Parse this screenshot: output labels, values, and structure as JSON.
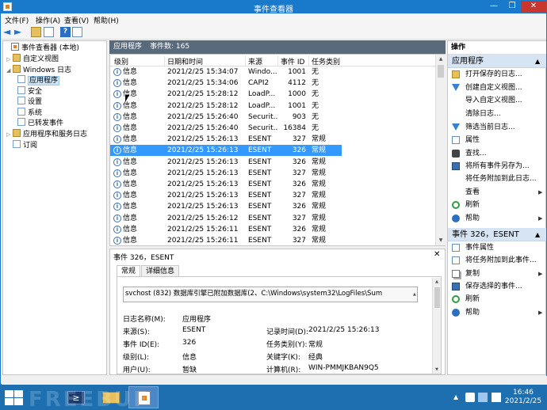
{
  "window": {
    "title": "事件查看器",
    "min": "—",
    "max": "❐",
    "close": "✕"
  },
  "menu": [
    "文件(F)",
    "操作(A)",
    "查看(V)",
    "帮助(H)"
  ],
  "toolbar": {
    "back": "◄",
    "forward": "►",
    "help": "?"
  },
  "tree": {
    "root": "事件查看器 (本地)",
    "custom_views": "自定义视图",
    "windows_logs": "Windows 日志",
    "logs": [
      "应用程序",
      "安全",
      "设置",
      "系统",
      "已转发事件"
    ],
    "app_service_logs": "应用程序和服务日志",
    "subscriptions": "订阅"
  },
  "list": {
    "log_name": "应用程序",
    "event_count_label": "事件数: 165",
    "columns": [
      "级别",
      "日期和时间",
      "来源",
      "事件 ID",
      "任务类别"
    ],
    "rows": [
      [
        "信息",
        "2021/2/25 15:34:07",
        "Windo...",
        "1001",
        "无"
      ],
      [
        "信息",
        "2021/2/25 15:34:06",
        "CAPI2",
        "4112",
        "无"
      ],
      [
        "信息",
        "2021/2/25 15:28:12",
        "LoadP...",
        "1000",
        "无"
      ],
      [
        "信息",
        "2021/2/25 15:28:12",
        "LoadP...",
        "1001",
        "无"
      ],
      [
        "信息",
        "2021/2/25 15:26:40",
        "Securit...",
        "903",
        "无"
      ],
      [
        "信息",
        "2021/2/25 15:26:40",
        "Securit...",
        "16384",
        "无"
      ],
      [
        "信息",
        "2021/2/25 15:26:13",
        "ESENT",
        "327",
        "常规"
      ],
      [
        "信息",
        "2021/2/25 15:26:13",
        "ESENT",
        "326",
        "常规"
      ],
      [
        "信息",
        "2021/2/25 15:26:13",
        "ESENT",
        "326",
        "常规"
      ],
      [
        "信息",
        "2021/2/25 15:26:13",
        "ESENT",
        "327",
        "常规"
      ],
      [
        "信息",
        "2021/2/25 15:26:13",
        "ESENT",
        "326",
        "常规"
      ],
      [
        "信息",
        "2021/2/25 15:26:13",
        "ESENT",
        "327",
        "常规"
      ],
      [
        "信息",
        "2021/2/25 15:26:13",
        "ESENT",
        "326",
        "常规"
      ],
      [
        "信息",
        "2021/2/25 15:26:12",
        "ESENT",
        "327",
        "常规"
      ],
      [
        "信息",
        "2021/2/25 15:26:11",
        "ESENT",
        "326",
        "常规"
      ],
      [
        "信息",
        "2021/2/25 15:26:11",
        "ESENT",
        "327",
        "常规"
      ]
    ],
    "selected_index": 7
  },
  "detail": {
    "title": "事件 326，ESENT",
    "close": "✕",
    "tabs": [
      "常规",
      "详细信息"
    ],
    "description": "svchost (832) 数据库引擎已附加数据库(2、C:\\Windows\\system32\\LogFiles\\Sum",
    "fields": {
      "log_name_label": "日志名称(M):",
      "log_name": "应用程序",
      "source_label": "来源(S):",
      "source": "ESENT",
      "logged_label": "记录时间(D):",
      "logged": "2021/2/25 15:26:13",
      "event_id_label": "事件 ID(E):",
      "event_id": "326",
      "task_label": "任务类别(Y):",
      "task": "常规",
      "level_label": "级别(L):",
      "level": "信息",
      "keywords_label": "关键字(K):",
      "keywords": "经典",
      "user_label": "用户(U):",
      "user": "暂缺",
      "computer_label": "计算机(R):",
      "computer": "WIN-PMMJKBAN9Q5"
    }
  },
  "actions": {
    "title": "操作",
    "section1": "应用程序",
    "items1": [
      "打开保存的日志...",
      "创建自定义视图...",
      "导入自定义视图...",
      "清除日志...",
      "筛选当前日志...",
      "属性",
      "查找...",
      "将所有事件另存为...",
      "将任务附加到此日志...",
      "查看",
      "刷新",
      "帮助"
    ],
    "section2": "事件 326，ESENT",
    "items2": [
      "事件属性",
      "将任务附加到此事件...",
      "复制",
      "保存选择的事件...",
      "刷新",
      "帮助"
    ]
  },
  "taskbar": {
    "time": "16:46",
    "date": "2021/2/25",
    "ps_glyph": "≥",
    "tray_up": "▲"
  },
  "watermark": "FREEBUF"
}
